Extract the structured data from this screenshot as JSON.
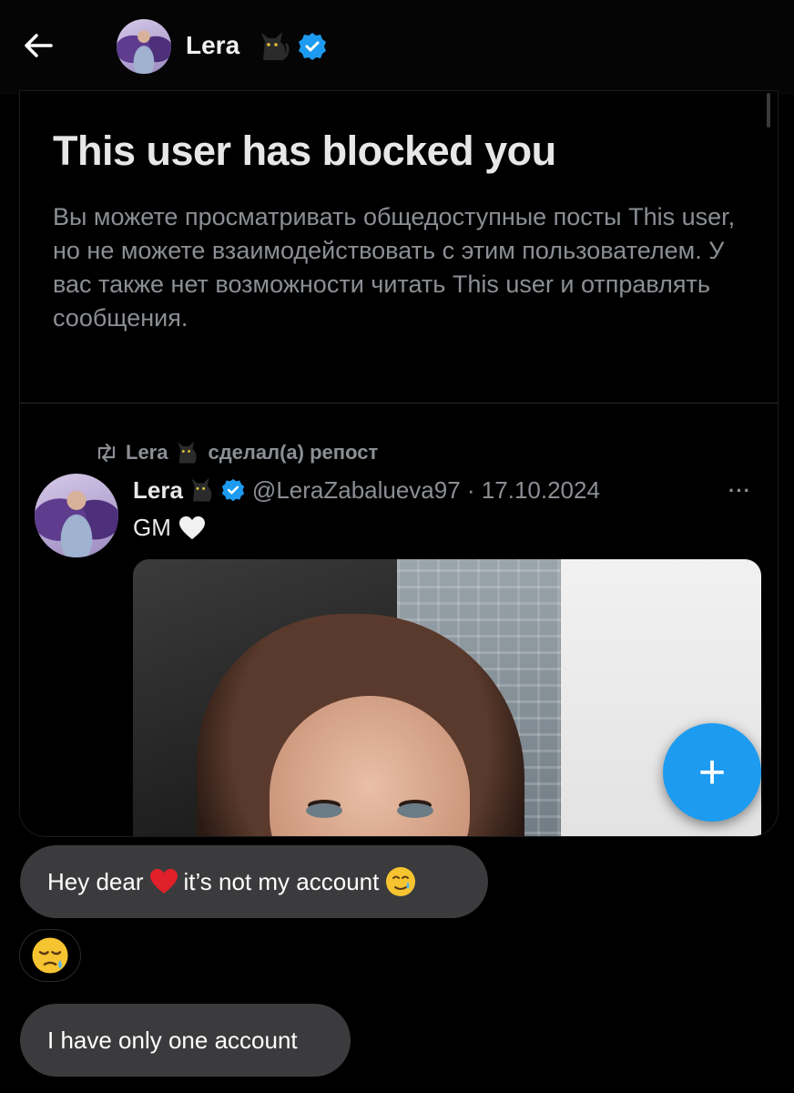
{
  "header": {
    "back_label": "back",
    "name": "Lera"
  },
  "blocked": {
    "title": "This user has blocked you",
    "description": "Вы можете просматривать общедоступные посты This user, но не можете взаимодействовать с этим пользователем. У вас также нет возможности читать This user и отправлять сообщения."
  },
  "tweet": {
    "repost_name": "Lera",
    "repost_suffix": "сделал(а) репост",
    "author": "Lera",
    "handle_date": "@LeraZabalueva97 · 17.10.2024",
    "more": "···",
    "text": "GM"
  },
  "chat": {
    "msg1_a": "Hey dear",
    "msg1_b": "it’s not my account",
    "msg3": "I have only one account"
  },
  "fab": {
    "label": "+"
  },
  "colors": {
    "accent": "#1d9bf0",
    "bubble": "#3b3b3d",
    "background": "#000000"
  },
  "icons": [
    "back-arrow-icon",
    "cat-emoji-icon",
    "verified-badge-icon",
    "repost-icon",
    "white-heart-icon",
    "red-heart-icon",
    "tear-smile-emoji-icon",
    "sleepy-face-emoji-icon",
    "plus-icon"
  ]
}
